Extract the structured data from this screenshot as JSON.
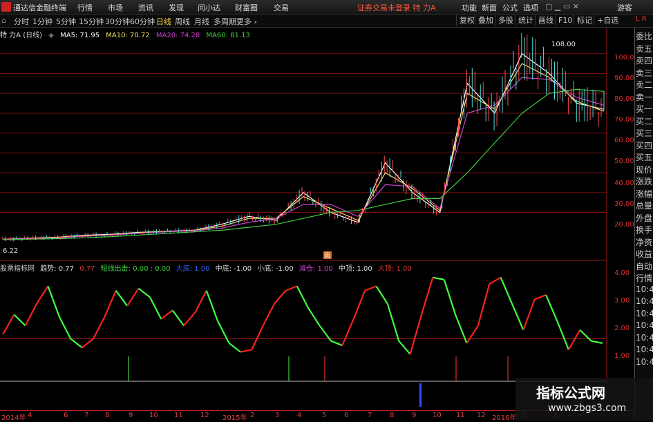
{
  "menubar": {
    "app_title": "通达信金融终端",
    "items": [
      "行情",
      "市场",
      "资讯",
      "发现",
      "问小达",
      "财富圈",
      "交易"
    ],
    "status": "证券交易未登录",
    "stock": "特 力A",
    "right": [
      "功能",
      "新面",
      "公式",
      "选项"
    ],
    "user": "游客"
  },
  "toolbar": {
    "periods": [
      "分时",
      "1分钟",
      "5分钟",
      "15分钟",
      "30分钟",
      "60分钟",
      "日线",
      "周线",
      "月线",
      "多周期",
      "更多 ›"
    ],
    "active": "日线",
    "right": [
      "复权",
      "叠加",
      "多股",
      "统计",
      "画线",
      "F10",
      "标记",
      "+自选"
    ]
  },
  "main_chart": {
    "stock_label": "特 力A (日线)",
    "ma5": "MA5: 71.95",
    "ma10": "MA10: 70.72",
    "ma20": "MA20: 74.28",
    "ma60": "MA60: 81.13",
    "high_label": "108.00",
    "low_label": "6.22",
    "marker": "固",
    "y_ticks": [
      "100.0",
      "90.00",
      "80.00",
      "70.00",
      "60.00",
      "50.00",
      "40.00",
      "30.00",
      "20.00"
    ],
    "colors": {
      "ma5": "#ffffff",
      "ma10": "#f0e060",
      "ma20": "#d040d0",
      "ma60": "#40d040"
    }
  },
  "indicator": {
    "name": "股票指标网",
    "trend": "趋势: 0.77",
    "trend_val": "0.77",
    "short_out": "短线出击: 0.00 : 0.00",
    "big_bottom": "大底: 1.00",
    "mid_bottom": "中底: -1.00",
    "small_bottom": "小底: -1.00",
    "reduce": "减仓: 1.00",
    "mid_top": "中顶: 1.00",
    "big_top": "大顶: 1.00",
    "y_ticks": [
      "4.00",
      "3.00",
      "2.00",
      "1.00"
    ]
  },
  "sidebar": {
    "corner_l": "L",
    "corner_r": "R",
    "items": [
      "委比",
      "卖五",
      "卖四",
      "卖三",
      "卖二",
      "卖一",
      "买一",
      "买二",
      "买三",
      "买四",
      "买五",
      "现价",
      "涨跌",
      "涨幅",
      "总量",
      "外盘",
      "换手",
      "净资",
      "收益",
      "自动",
      "行情",
      "10:4",
      "10:4",
      "10:4",
      "10:4",
      "10:4",
      "10:4",
      "10:4"
    ]
  },
  "xaxis": {
    "ticks": [
      "2014年",
      "4",
      "6",
      "7",
      "8",
      "9",
      "10",
      "11",
      "12",
      "2015年",
      "2",
      "3",
      "4",
      "5",
      "6",
      "7",
      "8",
      "9",
      "10",
      "11",
      "12",
      "2016年",
      "2",
      "3"
    ]
  },
  "watermark": {
    "title": "指标公式网",
    "url": "www.zbgs3.com"
  },
  "chart_data": [
    {
      "type": "line",
      "title": "特 力A (日线)",
      "series": [
        {
          "name": "MA5",
          "values": [
            6.5,
            7,
            7.5,
            8.5,
            9,
            10,
            10.5,
            11,
            14,
            18,
            16,
            30,
            20,
            15,
            45,
            30,
            20,
            85,
            70,
            100,
            90,
            75,
            72
          ]
        },
        {
          "name": "MA10",
          "values": [
            6.5,
            7,
            7.5,
            8.3,
            8.8,
            9.8,
            10.4,
            11,
            13,
            17,
            17,
            28,
            22,
            16,
            40,
            32,
            21,
            80,
            72,
            95,
            88,
            76,
            71
          ]
        },
        {
          "name": "MA20",
          "values": [
            6.5,
            6.8,
            7.2,
            8,
            8.6,
            9.5,
            10.2,
            10.8,
            12,
            15,
            17,
            24,
            24,
            18,
            34,
            33,
            22,
            70,
            74,
            88,
            87,
            78,
            74
          ]
        },
        {
          "name": "MA60",
          "values": [
            6.3,
            6.5,
            6.8,
            7.2,
            7.8,
            8.6,
            9.4,
            10.2,
            11,
            12.5,
            14,
            17,
            20,
            21,
            24,
            27,
            27,
            40,
            55,
            70,
            80,
            82,
            81
          ]
        }
      ],
      "ylim": [
        0,
        110
      ]
    },
    {
      "type": "line",
      "title": "股票指标网",
      "series": [
        {
          "name": "趋势",
          "values": [
            1.2,
            2.1,
            1.6,
            2.6,
            3.4,
            2.0,
            1.0,
            0.6,
            1.0,
            2.0,
            3.2,
            2.5,
            3.3,
            2.9,
            1.9,
            2.3,
            1.6,
            2.2,
            3.2,
            1.8,
            0.8,
            0.4,
            0.5,
            1.6,
            2.6,
            3.2,
            3.4,
            2.4,
            1.6,
            0.9,
            0.7,
            1.9,
            3.2,
            3.4,
            2.6,
            0.9,
            0.3,
            2.1,
            3.8,
            3.7,
            2.1,
            0.8,
            1.6,
            3.5,
            3.8,
            2.6,
            1.4,
            2.8,
            3.0,
            1.8,
            0.5,
            1.4,
            0.9,
            0.8
          ]
        }
      ],
      "ylim": [
        -1,
        4.2
      ]
    }
  ]
}
